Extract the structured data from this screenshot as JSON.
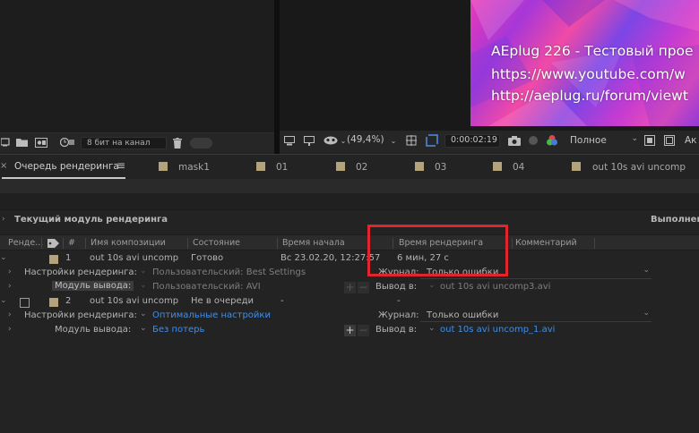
{
  "left_toolbar": {
    "bit_depth": "8 бит на канал"
  },
  "viewer": {
    "overlay_lines": [
      "AEplug 226 - Тестовый прое",
      "https://www.youtube.com/w",
      "http://aeplug.ru/forum/viewt"
    ],
    "zoom": "(49,4%)",
    "timecode": "0:00:02:19",
    "resolution": "Полное",
    "right_cut": "Ак"
  },
  "tabs": {
    "active": "Очередь рендеринга",
    "menu_glyph": "≡",
    "items": [
      "mask1",
      "01",
      "02",
      "03",
      "04",
      "out 10s avi uncomp"
    ]
  },
  "section": {
    "title": "Текущий модуль рендеринга",
    "right_label": "Выполнено"
  },
  "columns": {
    "render": "Ренде...",
    "num": "#",
    "comp": "Имя композиции",
    "status": "Состояние",
    "started": "Время начала",
    "render_time": "Время рендеринга",
    "comment": "Комментарий"
  },
  "rows": {
    "item1": {
      "num": "1",
      "comp": "out 10s avi uncomp",
      "status": "Готово",
      "started": "Вс 23.02.20, 12:27:57",
      "render_time": "6 мин, 27 с",
      "settings_label": "Настройки рендеринга:",
      "settings_value": "Пользовательский: Best Settings",
      "log_label": "Журнал:",
      "log_value": "Только ошибки",
      "module_label": "Модуль вывода:",
      "module_value": "Пользовательский: AVI",
      "output_label": "Вывод в:",
      "output_value": "out 10s avi uncomp3.avi"
    },
    "item2": {
      "num": "2",
      "comp": "out 10s avi uncomp",
      "status": "Не в очереди",
      "started": "-",
      "render_time": "-",
      "settings_label": "Настройки рендеринга:",
      "settings_value": "Оптимальные настройки",
      "log_label": "Журнал:",
      "log_value": "Только ошибки",
      "module_label": "Модуль вывода:",
      "module_value": "Без потерь",
      "output_label": "Вывод в:",
      "output_value": "out 10s avi uncomp_1.avi"
    }
  },
  "colors": {
    "highlight": "#e0262b",
    "link": "#3f8fe8",
    "swatch": "#b4a27a"
  }
}
